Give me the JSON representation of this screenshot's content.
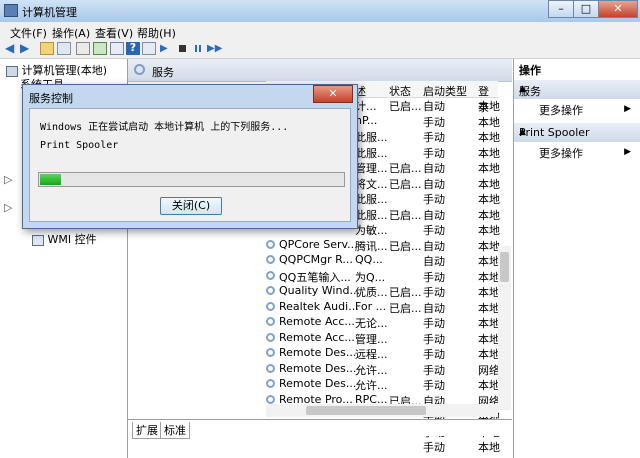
{
  "window": {
    "title": "计算机管理"
  },
  "menu": [
    "文件(F)",
    "操作(A)",
    "查看(V)",
    "帮助(H)"
  ],
  "tree": {
    "root": "计算机管理(本地)",
    "system_tools": "系统工具",
    "wmi": "WMI 控件"
  },
  "center": {
    "header": "服务",
    "columns": [
      "述",
      "状态",
      "启动类型",
      "登录"
    ],
    "rows": [
      {
        "name": "",
        "desc": "计...",
        "status": "已启...",
        "start": "自动",
        "login": "本地"
      },
      {
        "name": "",
        "desc": "nP...",
        "status": "",
        "start": "手动",
        "login": "本地"
      },
      {
        "name": "",
        "desc": "此服...",
        "status": "",
        "start": "手动",
        "login": "本地"
      },
      {
        "name": "",
        "desc": "此服...",
        "status": "",
        "start": "手动",
        "login": "本地"
      },
      {
        "name": "",
        "desc": "管理...",
        "status": "已启...",
        "start": "自动",
        "login": "本地"
      },
      {
        "name": "",
        "desc": "将文...",
        "status": "已启...",
        "start": "自动",
        "login": "本地"
      },
      {
        "name": "",
        "desc": "此服...",
        "status": "",
        "start": "手动",
        "login": "本地"
      },
      {
        "name": "",
        "desc": "此服...",
        "status": "已启...",
        "start": "自动",
        "login": "本地"
      },
      {
        "name": "",
        "desc": "为敏...",
        "status": "",
        "start": "手动",
        "login": "本地"
      },
      {
        "name": "QPCore Serv...",
        "desc": "腾讯...",
        "status": "已启...",
        "start": "自动",
        "login": "本地"
      },
      {
        "name": "QQPCMgr R...",
        "desc": "QQ...",
        "status": "",
        "start": "自动",
        "login": "本地"
      },
      {
        "name": "QQ五笔输入...",
        "desc": "为Q...",
        "status": "",
        "start": "手动",
        "login": "本地"
      },
      {
        "name": "Quality Wind...",
        "desc": "优质...",
        "status": "已启...",
        "start": "手动",
        "login": "本地"
      },
      {
        "name": "Realtek Audi...",
        "desc": "For ...",
        "status": "已启...",
        "start": "自动",
        "login": "本地"
      },
      {
        "name": "Remote Acc...",
        "desc": "无论...",
        "status": "",
        "start": "手动",
        "login": "本地"
      },
      {
        "name": "Remote Acc...",
        "desc": "管理...",
        "status": "",
        "start": "手动",
        "login": "本地"
      },
      {
        "name": "Remote Des...",
        "desc": "远程...",
        "status": "",
        "start": "手动",
        "login": "本地"
      },
      {
        "name": "Remote Des...",
        "desc": "允许...",
        "status": "",
        "start": "手动",
        "login": "网络"
      },
      {
        "name": "Remote Des...",
        "desc": "允许...",
        "status": "",
        "start": "手动",
        "login": "本地"
      },
      {
        "name": "Remote Pro...",
        "desc": "RPC...",
        "status": "已启...",
        "start": "自动",
        "login": "网络"
      },
      {
        "name": "",
        "desc": "",
        "status": "",
        "start": "手动",
        "login": "本地"
      },
      {
        "name": "",
        "desc": "",
        "status": "",
        "start": "手动",
        "login": "本地"
      },
      {
        "name": "",
        "desc": "",
        "status": "",
        "start": "手动",
        "login": "本地"
      }
    ],
    "tabs": [
      "扩展",
      "标准"
    ]
  },
  "actions": {
    "title": "操作",
    "section1": "服务",
    "more1": "更多操作",
    "section2": "Print Spooler",
    "more2": "更多操作"
  },
  "dialog": {
    "title": "服务控制",
    "message": "Windows 正在尝试启动 本地计算机 上的下列服务...",
    "service": "Print Spooler",
    "progress": 0.07,
    "close_button": "关闭(C)"
  },
  "colors": {
    "accent": "#1a8e1a",
    "titlebar": "#bcd5f0"
  }
}
